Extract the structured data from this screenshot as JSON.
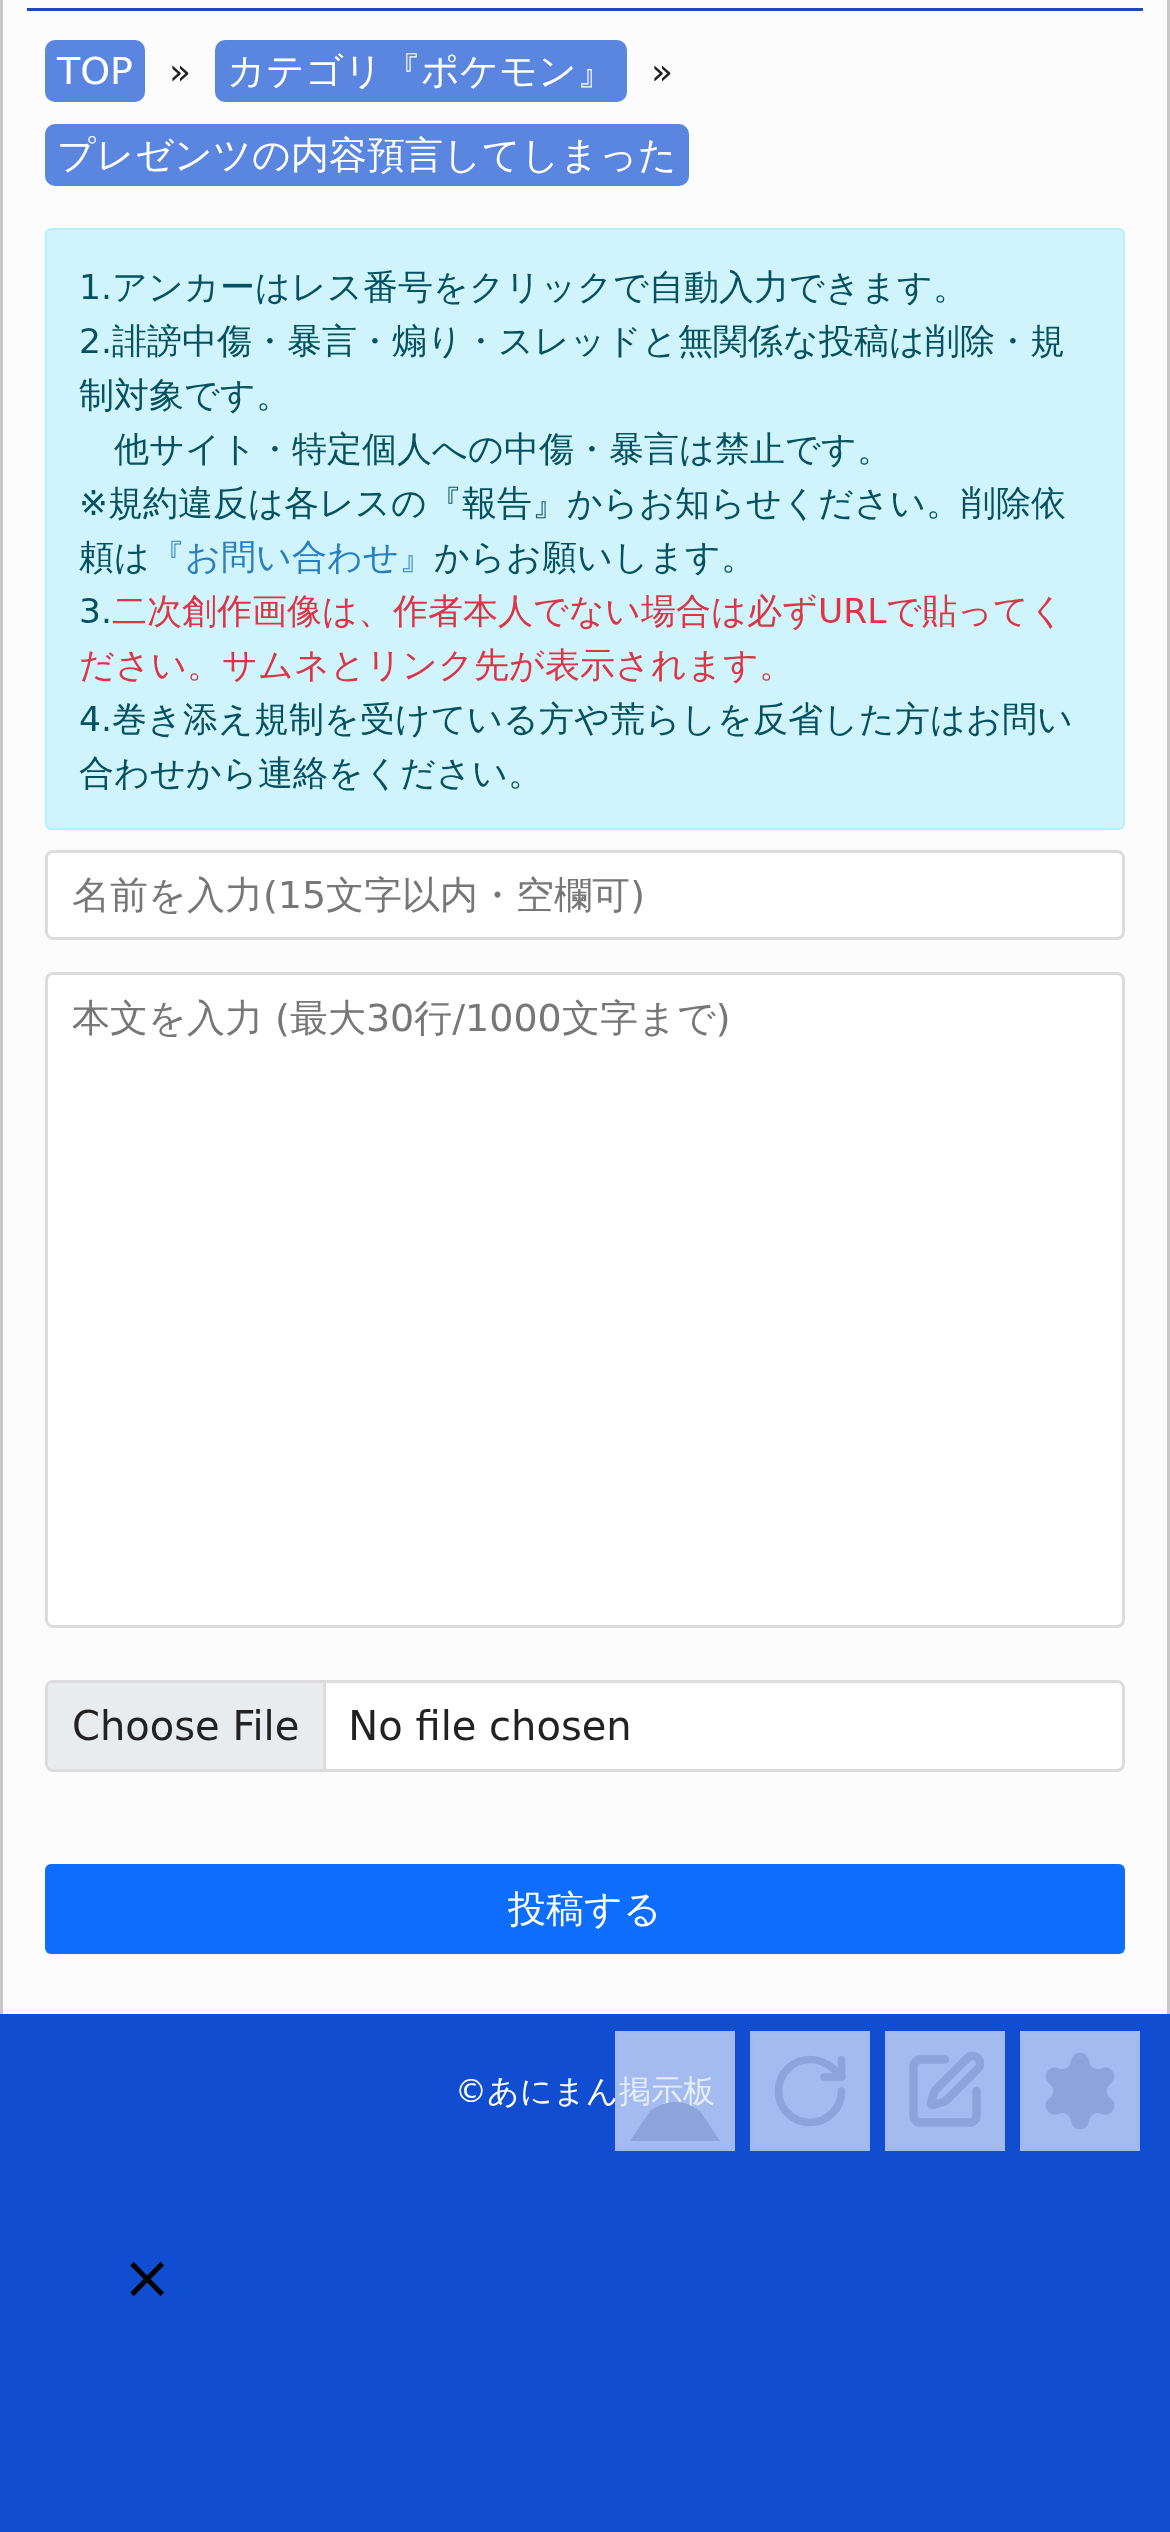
{
  "breadcrumbs": [
    {
      "label": "TOP",
      "separator": "»"
    },
    {
      "label": "カテゴリ『ポケモン』",
      "separator": "»"
    },
    {
      "label": "プレゼンツの内容預言してしまった"
    }
  ],
  "notice": [
    {
      "segments": [
        {
          "kind": "plain",
          "text": "1.アンカーはレス番号をクリックで自動入力できます。"
        }
      ]
    },
    {
      "segments": [
        {
          "kind": "plain",
          "text": "2.誹謗中傷・暴言・煽り・スレッドと無関係な投稿は削除・規制対象です。"
        }
      ]
    },
    {
      "segments": [
        {
          "kind": "plain",
          "text": "　他サイト・特定個人への中傷・暴言は禁止です。"
        }
      ]
    },
    {
      "segments": [
        {
          "kind": "plain",
          "text": "※規約違反は各レスの『報告』からお知らせください。削除依頼は"
        },
        {
          "kind": "link",
          "text": "『お問い合わせ』"
        },
        {
          "kind": "plain",
          "text": "からお願いします。"
        }
      ]
    },
    {
      "segments": [
        {
          "kind": "plain",
          "text": "3."
        },
        {
          "kind": "alert",
          "text": "二次創作画像は、作者本人でない場合は必ずURLで貼ってください。サムネとリンク先が表示されます。"
        }
      ]
    },
    {
      "segments": [
        {
          "kind": "plain",
          "text": "4.巻き添え規制を受けている方や荒らしを反省した方はお問い合わせから連絡をください。"
        }
      ]
    }
  ],
  "name_field": {
    "placeholder": "名前を入力(15文字以内・空欄可)"
  },
  "body_field": {
    "placeholder": "本文を入力 (最大30行/1000文字まで)"
  },
  "file_input": {
    "button": "Choose File",
    "status": "No file chosen"
  },
  "submit_button": "投稿する",
  "footer": {
    "copyright": "©あにまん掲示板",
    "close": "×"
  },
  "floating_buttons": [
    {
      "kind": "top"
    },
    {
      "kind": "reload"
    },
    {
      "kind": "write"
    },
    {
      "kind": "settings"
    }
  ]
}
